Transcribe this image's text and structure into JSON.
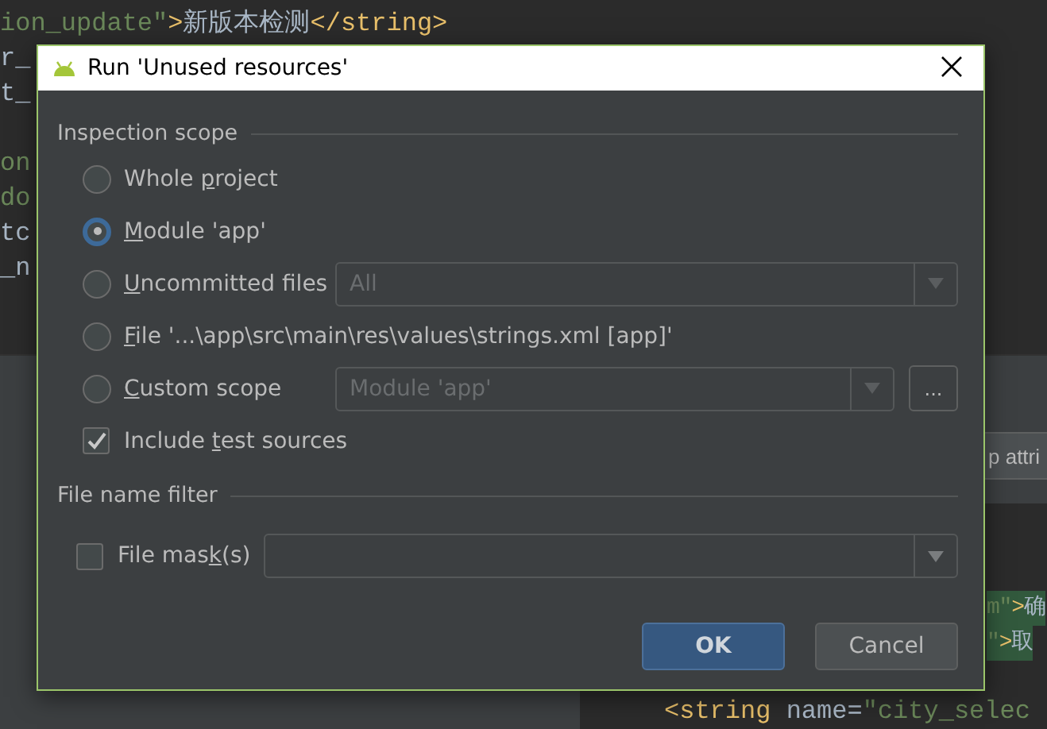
{
  "editor": {
    "code_blocks": [
      {
        "lines": [
          {
            "segments": [
              {
                "kind": "attr",
                "text": "ion_update\""
              },
              {
                "kind": "tag",
                "text": ">"
              },
              {
                "kind": "text",
                "text": "新版本检测"
              },
              {
                "kind": "tag",
                "text": "</string>"
              }
            ]
          },
          {
            "segments": [
              {
                "kind": "text",
                "text": "r_"
              }
            ]
          },
          {
            "segments": [
              {
                "kind": "text",
                "text": "t_"
              }
            ]
          }
        ]
      },
      {
        "lines": [
          {
            "segments": [
              {
                "kind": "attr",
                "text": "on"
              }
            ]
          },
          {
            "segments": [
              {
                "kind": "attr",
                "text": "do"
              }
            ]
          },
          {
            "segments": [
              {
                "kind": "text",
                "text": "tc"
              }
            ]
          },
          {
            "segments": [
              {
                "kind": "text",
                "text": "_n"
              }
            ]
          }
        ]
      }
    ],
    "toolbar_button": "p attri",
    "side_code_lines": [
      {
        "segments": [
          {
            "kind": "attr",
            "text": "m\""
          },
          {
            "kind": "tag",
            "text": ">"
          },
          {
            "kind": "text",
            "text": "确"
          }
        ]
      },
      {
        "segments": [
          {
            "kind": "attr",
            "text": "\""
          },
          {
            "kind": "tag",
            "text": ">"
          },
          {
            "kind": "text",
            "text": "取"
          }
        ]
      }
    ],
    "bottom_code_lines": [
      {
        "segments": [
          {
            "kind": "tag",
            "text": "<string "
          },
          {
            "kind": "text",
            "text": "name="
          },
          {
            "kind": "attr",
            "text": "\"city_selec"
          }
        ]
      }
    ]
  },
  "dialog": {
    "title": "Run 'Unused resources'",
    "scope_title": "Inspection scope",
    "scope_options": [
      {
        "kind": "radio",
        "before": "Whole ",
        "mnemonic": "p",
        "after": "roject",
        "selected": false
      },
      {
        "kind": "radio",
        "mnemonic": "M",
        "after": "odule 'app'",
        "selected": true
      },
      {
        "kind": "radio",
        "mnemonic": "U",
        "after": "ncommitted files",
        "selected": false,
        "field": {
          "value": "All",
          "disabled": true
        }
      },
      {
        "kind": "radio",
        "mnemonic": "F",
        "after": "ile '...\\app\\src\\main\\res\\values\\strings.xml [app]'",
        "selected": false
      },
      {
        "kind": "radio",
        "mnemonic": "C",
        "after": "ustom scope",
        "selected": false,
        "field": {
          "value": "Module 'app'",
          "disabled": true
        },
        "browse_button": "..."
      },
      {
        "kind": "checkbox",
        "before": "Include ",
        "mnemonic": "t",
        "after": "est sources",
        "checked": true
      }
    ],
    "filter_title": "File name filter",
    "file_mask": {
      "before": "File mas",
      "mnemonic": "k",
      "after": "(s)",
      "checked": false,
      "field": {
        "disabled": false
      }
    },
    "buttons": [
      {
        "label": "OK",
        "default": true
      },
      {
        "label": "Cancel",
        "default": false
      }
    ]
  }
}
